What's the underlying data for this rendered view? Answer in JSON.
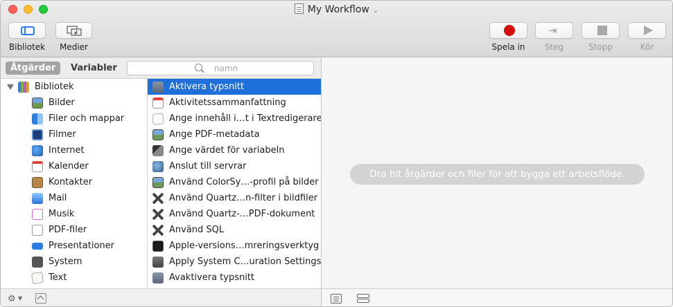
{
  "window": {
    "title": "My Workflow"
  },
  "toolbar": {
    "library_label": "Bibliotek",
    "media_label": "Medier",
    "record_label": "Spela in",
    "step_label": "Steg",
    "stop_label": "Stopp",
    "run_label": "Kör"
  },
  "left_panel": {
    "tabs": {
      "actions": "Åtgärder",
      "variables": "Variabler"
    },
    "search": {
      "placeholder": "namn",
      "value": ""
    },
    "categories": [
      {
        "label": "Bibliotek",
        "icon": "library-icon"
      },
      {
        "label": "Bilder",
        "icon": "photos-icon"
      },
      {
        "label": "Filer och mappar",
        "icon": "finder-icon"
      },
      {
        "label": "Filmer",
        "icon": "movies-icon"
      },
      {
        "label": "Internet",
        "icon": "globe-icon"
      },
      {
        "label": "Kalender",
        "icon": "calendar-icon"
      },
      {
        "label": "Kontakter",
        "icon": "contacts-icon"
      },
      {
        "label": "Mail",
        "icon": "mail-icon"
      },
      {
        "label": "Musik",
        "icon": "music-icon"
      },
      {
        "label": "PDF-filer",
        "icon": "pdf-icon"
      },
      {
        "label": "Presentationer",
        "icon": "presentation-icon"
      },
      {
        "label": "System",
        "icon": "system-icon"
      },
      {
        "label": "Text",
        "icon": "text-icon"
      }
    ],
    "actions": [
      {
        "label": "Aktivera typsnitt",
        "icon": "font-book-icon",
        "selected": true
      },
      {
        "label": "Aktivitetssammanfattning",
        "icon": "calendar-icon"
      },
      {
        "label": "Ange innehåll i…t i Textredigerare",
        "icon": "text-document-icon"
      },
      {
        "label": "Ange PDF-metadata",
        "icon": "preview-icon"
      },
      {
        "label": "Ange värdet för variabeln",
        "icon": "variable-icon"
      },
      {
        "label": "Anslut till servrar",
        "icon": "network-icon"
      },
      {
        "label": "Använd ColorSy…-profil på bilder",
        "icon": "preview-icon"
      },
      {
        "label": "Använd Quartz…n-filter i bildfiler",
        "icon": "tools-icon"
      },
      {
        "label": "Använd Quartz-…PDF-dokument",
        "icon": "tools-icon"
      },
      {
        "label": "Använd SQL",
        "icon": "tools-icon"
      },
      {
        "label": "Apple-versions…mreringsverktyg",
        "icon": "terminal-icon"
      },
      {
        "label": "Apply System C…uration Settings",
        "icon": "system-config-icon"
      },
      {
        "label": "Avaktivera typsnitt",
        "icon": "font-book-icon"
      }
    ]
  },
  "workflow": {
    "hint": "Dra hit åtgärder och filer för att bygga ett arbetsflöde."
  },
  "colors": {
    "selection": "#1e6fd9",
    "record": "#d30d0d",
    "hint_bg": "#d3d3d3"
  }
}
